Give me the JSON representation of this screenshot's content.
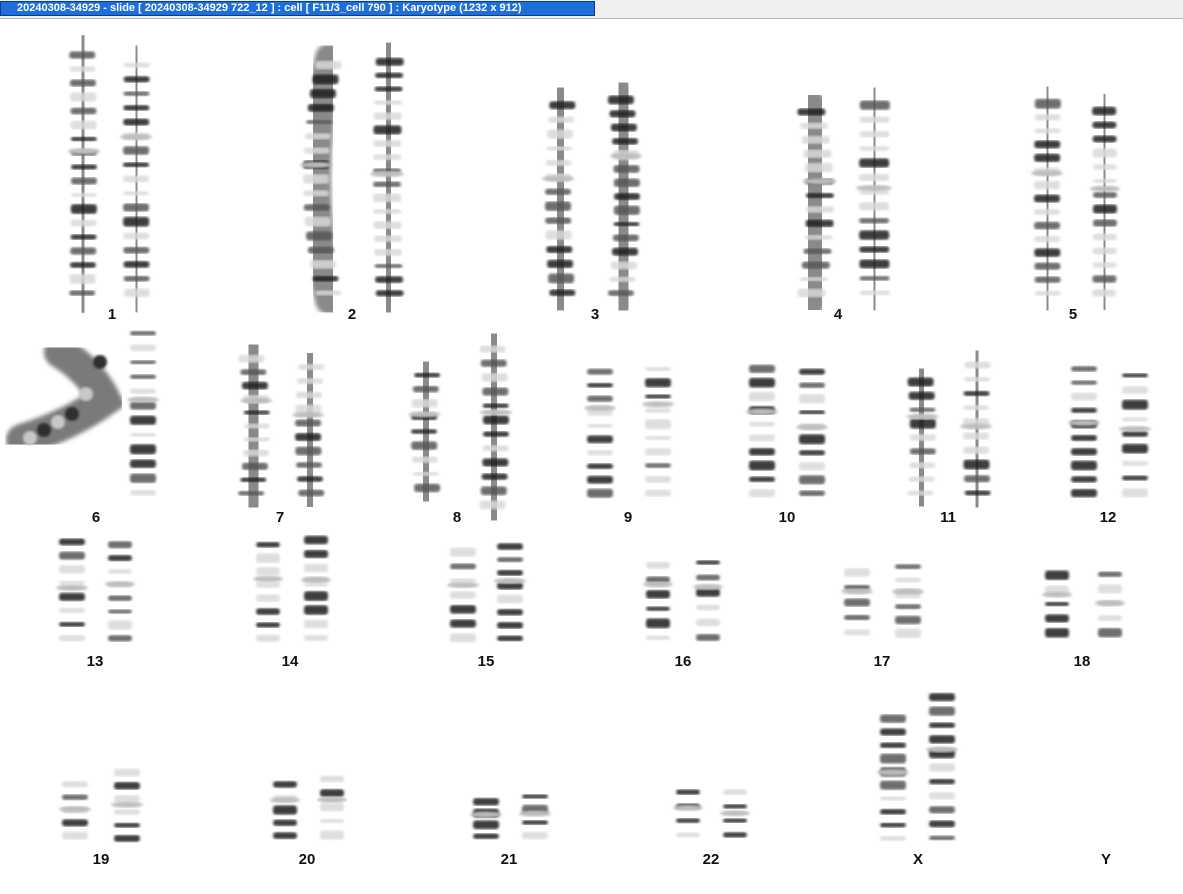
{
  "window": {
    "title": "20240308-34929 - slide [ 20240308-34929 722_12 ] : cell [ F11/3_cell 790 ] : Karyotype  (1232 x 912)"
  },
  "colors": {
    "title_bg": "#1f6fd8",
    "title_text": "#ffffff",
    "band_dark": "#2a2a2a",
    "band_light": "#d8d8d8",
    "background": "#ffffff"
  },
  "karyotype": {
    "chromosome_labels": [
      "1",
      "2",
      "3",
      "4",
      "5",
      "6",
      "7",
      "8",
      "9",
      "10",
      "11",
      "12",
      "13",
      "14",
      "15",
      "16",
      "17",
      "18",
      "19",
      "20",
      "21",
      "22",
      "X",
      "Y"
    ]
  }
}
